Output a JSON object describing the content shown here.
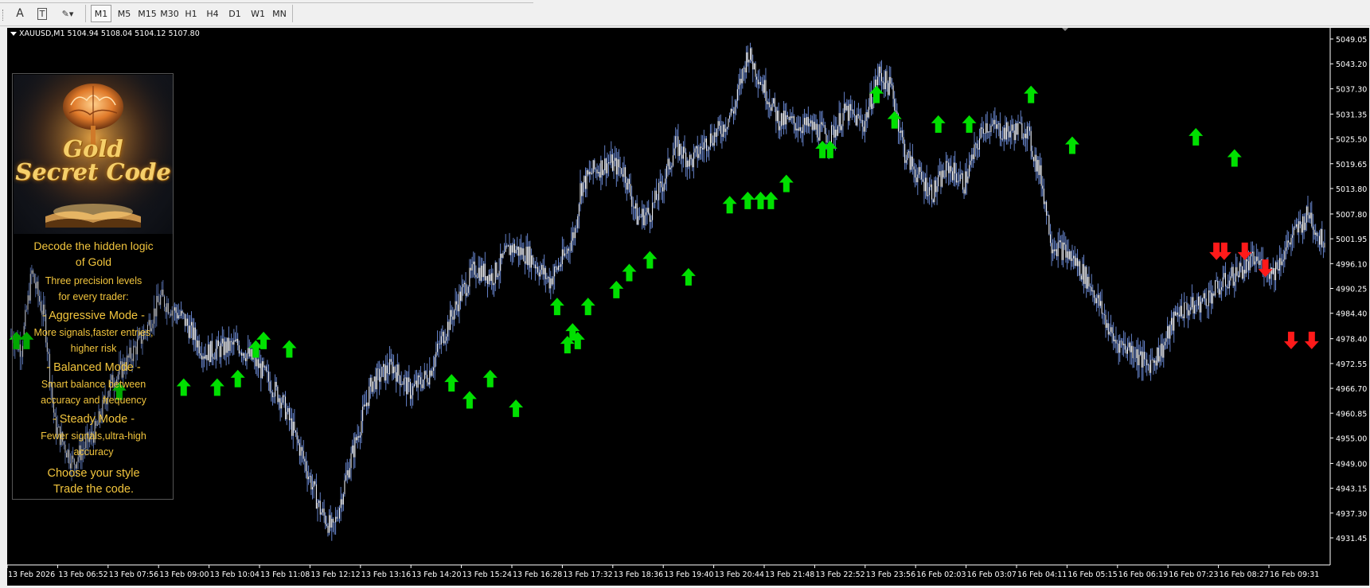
{
  "toolbar": {
    "tools": [
      {
        "name": "text-tool-icon",
        "label": "A"
      },
      {
        "name": "text-label-tool-icon",
        "label": "T"
      },
      {
        "name": "shapes-tool-icon",
        "label": "✎▾"
      }
    ],
    "timeframes": [
      "M1",
      "M5",
      "M15",
      "M30",
      "H1",
      "H4",
      "D1",
      "W1",
      "MN"
    ],
    "active_timeframe": "M1"
  },
  "chart": {
    "symbol_line": "XAUUSD,M1  5104.94 5108.04 5104.12 5107.80",
    "price_labels": [
      "5049.05",
      "5043.20",
      "5037.30",
      "5031.35",
      "5025.50",
      "5019.65",
      "5013.80",
      "5007.80",
      "5001.95",
      "4996.10",
      "4990.25",
      "4984.40",
      "4978.40",
      "4972.55",
      "4966.70",
      "4960.85",
      "4955.00",
      "4949.00",
      "4943.15",
      "4937.30",
      "4931.45"
    ],
    "time_labels": [
      "13 Feb 2026",
      "13 Feb 06:52",
      "13 Feb 07:56",
      "13 Feb 09:00",
      "13 Feb 10:04",
      "13 Feb 11:08",
      "13 Feb 12:12",
      "13 Feb 13:16",
      "13 Feb 14:20",
      "13 Feb 15:24",
      "13 Feb 16:28",
      "13 Feb 17:32",
      "13 Feb 18:36",
      "13 Feb 19:40",
      "13 Feb 20:44",
      "13 Feb 21:48",
      "13 Feb 22:52",
      "13 Feb 23:56",
      "16 Feb 02:03",
      "16 Feb 03:07",
      "16 Feb 04:11",
      "16 Feb 05:15",
      "16 Feb 06:19",
      "16 Feb 07:23",
      "16 Feb 08:27",
      "16 Feb 09:31"
    ],
    "colors": {
      "background": "#000000",
      "candles": "#ffffff",
      "wick": "#6f8fdc",
      "buy_arrow": "#00e000",
      "sell_arrow": "#ff1a1a",
      "axis_text": "#ffffff",
      "grid_frame": "#ffffff"
    }
  },
  "chart_data": {
    "type": "line",
    "title": "XAUUSD,M1",
    "ylim": [
      4931.45,
      5049.05
    ],
    "x": [
      "13 Feb 2026",
      "13 Feb 06:52",
      "13 Feb 07:56",
      "13 Feb 09:00",
      "13 Feb 10:04",
      "13 Feb 11:08",
      "13 Feb 12:12",
      "13 Feb 13:16",
      "13 Feb 14:20",
      "13 Feb 15:24",
      "13 Feb 16:28",
      "13 Feb 17:32",
      "13 Feb 18:36",
      "13 Feb 19:40",
      "13 Feb 20:44",
      "13 Feb 21:48",
      "13 Feb 22:52",
      "13 Feb 23:56",
      "16 Feb 02:03",
      "16 Feb 03:07",
      "16 Feb 04:11",
      "16 Feb 05:15",
      "16 Feb 06:19",
      "16 Feb 07:23",
      "16 Feb 08:27",
      "16 Feb 09:31"
    ],
    "series": [
      {
        "name": "XAUUSD,M1",
        "values": [
          4979,
          4970,
          4958,
          4966,
          4982,
          4976,
          4965,
          4935,
          4968,
          4982,
          4995,
          4986,
          5015,
          5024,
          5044,
          5028,
          5030,
          5022,
          5014,
          5028,
          4998,
          4974,
          4974,
          4990,
          4998,
          5005
        ]
      }
    ],
    "price_path": [
      [
        0,
        4979
      ],
      [
        4,
        4976
      ],
      [
        8,
        4994
      ],
      [
        13,
        4983
      ],
      [
        17,
        4958
      ],
      [
        24,
        4949
      ],
      [
        33,
        4957
      ],
      [
        38,
        4967
      ],
      [
        45,
        4973
      ],
      [
        52,
        4980
      ],
      [
        58,
        4988
      ],
      [
        67,
        4983
      ],
      [
        75,
        4975
      ],
      [
        88,
        4977
      ],
      [
        96,
        4972
      ],
      [
        105,
        4964
      ],
      [
        113,
        4951
      ],
      [
        120,
        4938
      ],
      [
        125,
        4933
      ],
      [
        131,
        4948
      ],
      [
        140,
        4968
      ],
      [
        148,
        4972
      ],
      [
        155,
        4966
      ],
      [
        162,
        4970
      ],
      [
        167,
        4978
      ],
      [
        174,
        4988
      ],
      [
        180,
        4995
      ],
      [
        187,
        4993
      ],
      [
        194,
        5000
      ],
      [
        201,
        4998
      ],
      [
        209,
        4992
      ],
      [
        215,
        4998
      ],
      [
        219,
        5004
      ],
      [
        221,
        5014
      ],
      [
        226,
        5018
      ],
      [
        232,
        5020
      ],
      [
        238,
        5018
      ],
      [
        243,
        5007
      ],
      [
        248,
        5008
      ],
      [
        253,
        5015
      ],
      [
        258,
        5024
      ],
      [
        264,
        5020
      ],
      [
        270,
        5025
      ],
      [
        276,
        5028
      ],
      [
        281,
        5033
      ],
      [
        286,
        5046
      ],
      [
        292,
        5038
      ],
      [
        298,
        5030
      ],
      [
        305,
        5029
      ],
      [
        312,
        5028
      ],
      [
        318,
        5026
      ],
      [
        324,
        5032
      ],
      [
        331,
        5029
      ],
      [
        337,
        5041
      ],
      [
        342,
        5037
      ],
      [
        347,
        5022
      ],
      [
        353,
        5016
      ],
      [
        358,
        5013
      ],
      [
        364,
        5019
      ],
      [
        370,
        5015
      ],
      [
        378,
        5029
      ],
      [
        386,
        5027
      ],
      [
        394,
        5028
      ],
      [
        400,
        5016
      ],
      [
        404,
        5001
      ],
      [
        409,
        4999
      ],
      [
        414,
        4996
      ],
      [
        420,
        4990
      ],
      [
        428,
        4978
      ],
      [
        435,
        4976
      ],
      [
        441,
        4972
      ],
      [
        447,
        4976
      ],
      [
        453,
        4985
      ],
      [
        460,
        4986
      ],
      [
        468,
        4990
      ],
      [
        476,
        4994
      ],
      [
        483,
        4997
      ],
      [
        490,
        4994
      ],
      [
        497,
        5002
      ],
      [
        504,
        5008
      ],
      [
        508,
        5002
      ]
    ],
    "buy_signals": [
      [
        2,
        4978
      ],
      [
        6,
        4978
      ],
      [
        42,
        4966
      ],
      [
        67,
        4967
      ],
      [
        80,
        4967
      ],
      [
        88,
        4969
      ],
      [
        95,
        4976
      ],
      [
        98,
        4978
      ],
      [
        108,
        4976
      ],
      [
        171,
        4968
      ],
      [
        178,
        4964
      ],
      [
        186,
        4969
      ],
      [
        196,
        4962
      ],
      [
        212,
        4986
      ],
      [
        216,
        4977
      ],
      [
        218,
        4980
      ],
      [
        220,
        4978
      ],
      [
        224,
        4986
      ],
      [
        235,
        4990
      ],
      [
        240,
        4994
      ],
      [
        248,
        4997
      ],
      [
        263,
        4993
      ],
      [
        279,
        5010
      ],
      [
        286,
        5011
      ],
      [
        291,
        5011
      ],
      [
        295,
        5011
      ],
      [
        301,
        5015
      ],
      [
        315,
        5023
      ],
      [
        318,
        5023
      ],
      [
        336,
        5036
      ],
      [
        343,
        5030
      ],
      [
        360,
        5029
      ],
      [
        372,
        5029
      ],
      [
        396,
        5036
      ],
      [
        412,
        5024
      ],
      [
        460,
        5026
      ],
      [
        475,
        5021
      ]
    ],
    "sell_signals": [
      [
        468,
        4999
      ],
      [
        471,
        4999
      ],
      [
        479,
        4999
      ],
      [
        487,
        4995
      ],
      [
        497,
        4978
      ],
      [
        505,
        4978
      ]
    ]
  },
  "panel": {
    "banner_title_1": "Gold",
    "banner_title_2": "Secret Code",
    "heading": "Decode the hidden logic\nof Gold",
    "intro": "Three precision levels\nfor every trader:",
    "aggressive_title": "- Aggressive Mode -",
    "aggressive_desc": "More signals,faster entries,\nhigher risk",
    "balanced_title": "- Balanced Mode -",
    "balanced_desc": "Smart balance between\naccuracy and frequency",
    "steady_title": "- Steady Mode -",
    "steady_desc": "Fewer signals,ultra-high\naccuracy",
    "cta": "Choose your style\nTrade the code."
  }
}
